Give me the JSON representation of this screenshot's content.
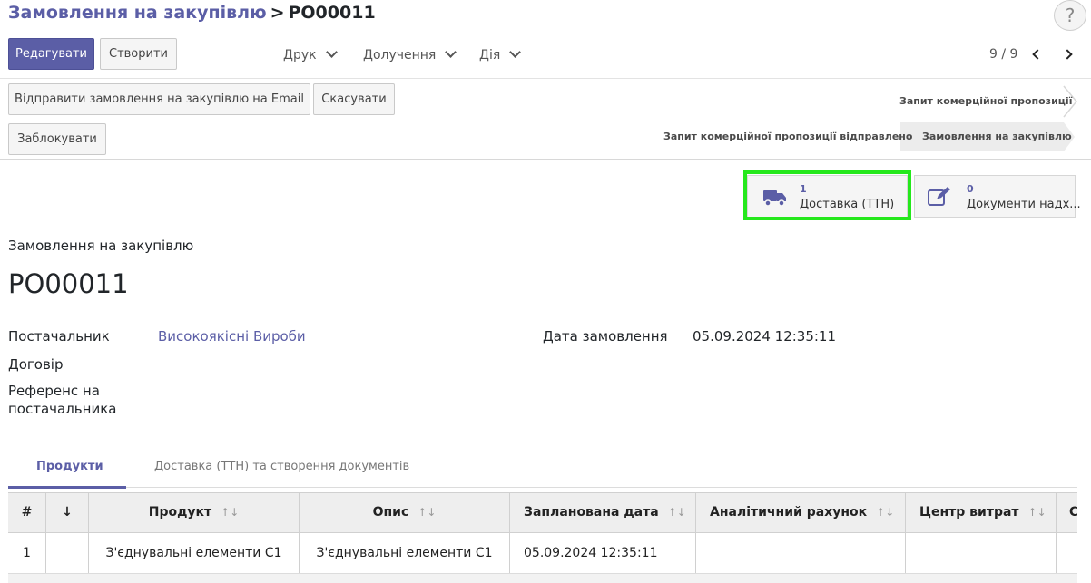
{
  "breadcrumb": {
    "parent": "Замовлення на закупівлю",
    "separator": ">",
    "current": "PO00011"
  },
  "help": "?",
  "toolbar": {
    "edit_label": "Редагувати",
    "create_label": "Створити",
    "print_label": "Друк",
    "attach_label": "Долучення",
    "action_label": "Дія"
  },
  "pager": {
    "value": "9 / 9"
  },
  "header_buttons": {
    "send_email": "Відправити замовлення на закупівлю на Email",
    "cancel": "Скасувати",
    "lock": "Заблокувати"
  },
  "stages": {
    "rfq": "Запит комерційної пропозиції",
    "rfq_sent": "Запит комерційної пропозиції відправлено",
    "purchase_order": "Замовлення на закупівлю"
  },
  "smart_buttons": {
    "delivery": {
      "count": "1",
      "label": "Доставка (ТТН)",
      "icon": "truck-icon"
    },
    "bills": {
      "count": "0",
      "label": "Документи надх...",
      "icon": "edit-icon"
    }
  },
  "form": {
    "record_type": "Замовлення на закупівлю",
    "name": "PO00011",
    "vendor_label": "Постачальник",
    "vendor_value": "Високоякісні Вироби",
    "contract_label": "Договір",
    "ref_label_1": "Референс на",
    "ref_label_2": "постачальника",
    "date_label": "Дата замовлення",
    "date_value": "05.09.2024 12:35:11"
  },
  "tabs": [
    "Продукти",
    "Доставка (ТТН) та створення документів"
  ],
  "table": {
    "headers": {
      "num": "#",
      "product": "Продукт",
      "desc": "Опис",
      "date": "Запланована дата",
      "analytic": "Аналітичний рахунок",
      "cost_center": "Центр витрат",
      "more": "С"
    },
    "rows": [
      {
        "num": "1",
        "product": "З'єднувальні елементи С1",
        "desc": "З'єднувальні елементи С1",
        "date": "05.09.2024 12:35:11"
      }
    ]
  },
  "colors": {
    "accent": "#5b5ea6",
    "highlight": "#25e81c"
  }
}
